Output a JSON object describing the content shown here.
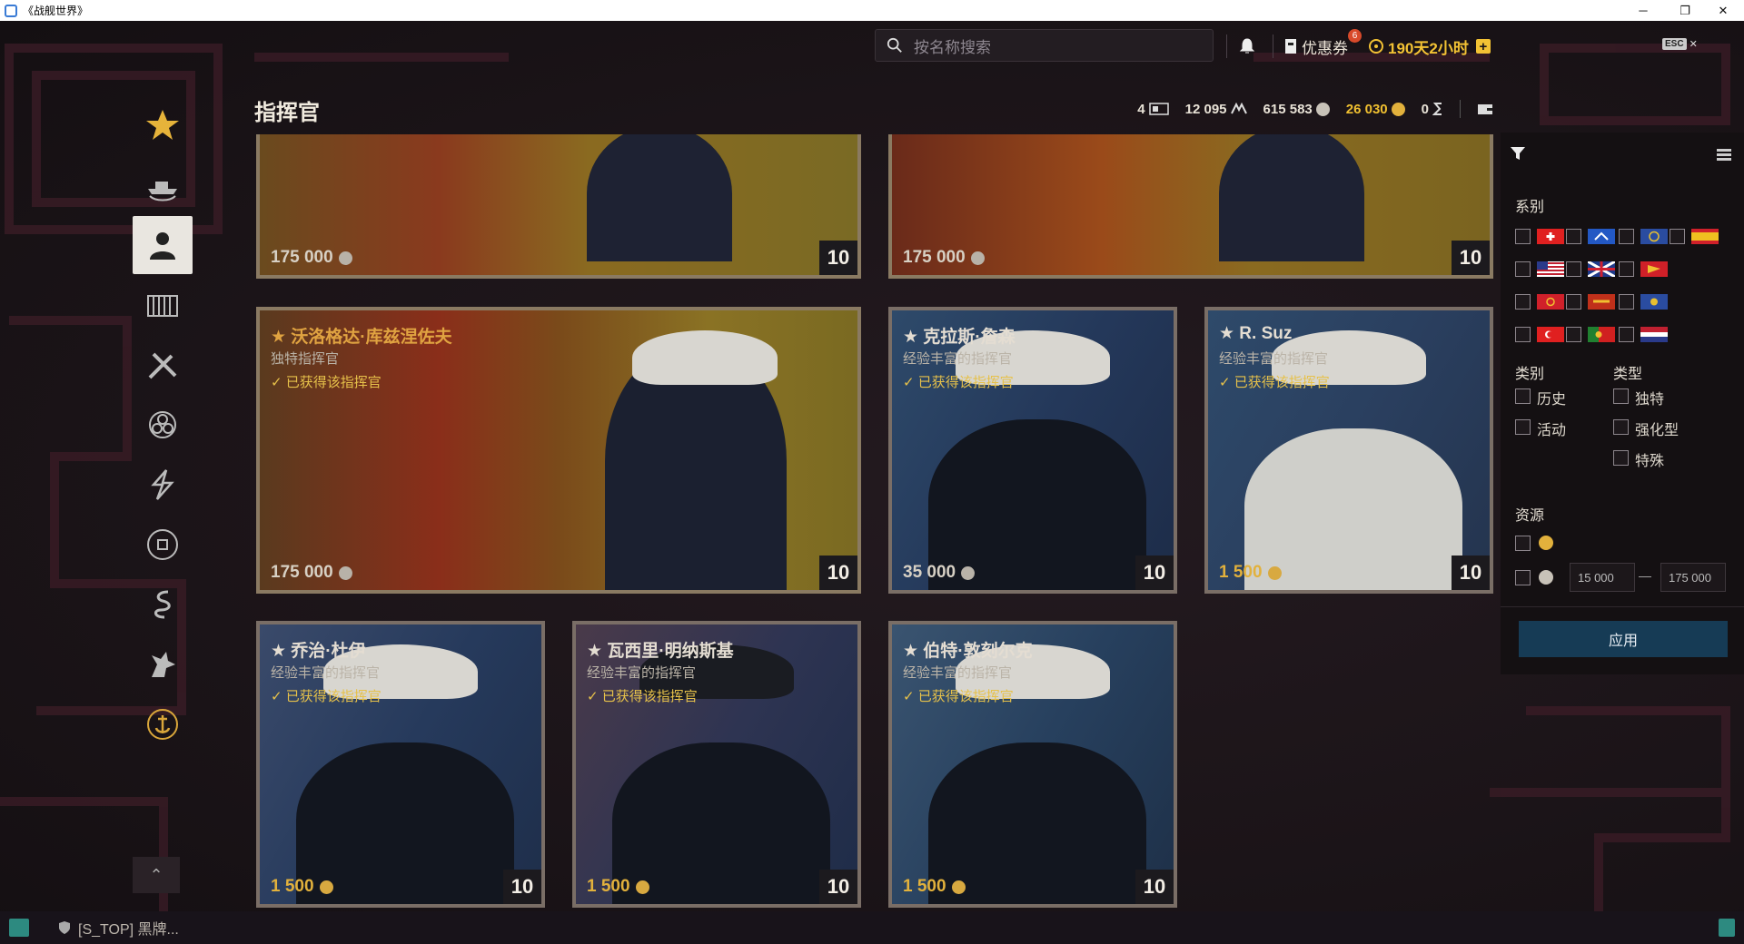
{
  "window": {
    "title": "《战舰世界》",
    "minimize": "─",
    "restore": "❐",
    "close": "✕"
  },
  "search": {
    "placeholder": "按名称搜索"
  },
  "topbar": {
    "coupon_label": "优惠券",
    "coupon_badge": "6",
    "premium_label": "190天2小时",
    "premium_add": "+",
    "esc_key": "ESC",
    "esc_close": "✕"
  },
  "page_title": "指挥官",
  "currencies": [
    {
      "icon": "slots-icon",
      "value": "4"
    },
    {
      "icon": "elite-xp-icon",
      "value": "12 095"
    },
    {
      "icon": "silver-credits-icon",
      "value": "615 583"
    },
    {
      "icon": "doubloons-icon",
      "value": "26 030"
    },
    {
      "icon": "steel-icon",
      "value": "0"
    }
  ],
  "nav": {
    "items": [
      {
        "icon": "star-icon"
      },
      {
        "icon": "ship-emblem-icon"
      },
      {
        "icon": "commander-icon"
      },
      {
        "icon": "port-buildings-icon"
      },
      {
        "icon": "crossed-tools-icon"
      },
      {
        "icon": "flag-roundel-icon"
      },
      {
        "icon": "lightning-icon"
      },
      {
        "icon": "coin-seal-icon"
      },
      {
        "icon": "dragon-icon"
      },
      {
        "icon": "griffin-icon"
      },
      {
        "icon": "anchor-wreath-icon"
      }
    ],
    "scroll_up": "⌃"
  },
  "cards_top": [
    {
      "price": "175 000",
      "level": "10"
    },
    {
      "price": "175 000",
      "level": "10"
    }
  ],
  "cards": [
    {
      "title": "★ 沃洛格达·库兹涅佐夫",
      "subtitle": "独特指挥官",
      "owned": "✓ 已获得该指挥官",
      "price": "175 000",
      "level": "10",
      "currency": "silver"
    },
    {
      "title": "★ 克拉斯·詹森",
      "subtitle": "经验丰富的指挥官",
      "owned": "✓ 已获得该指挥官",
      "price": "35 000",
      "level": "10",
      "currency": "silver"
    },
    {
      "title": "★ R. Suz",
      "subtitle": "经验丰富的指挥官",
      "owned": "✓ 已获得该指挥官",
      "price": "1 500",
      "level": "10",
      "currency": "gold"
    },
    {
      "title": "★ 乔治·杜伊",
      "subtitle": "经验丰富的指挥官",
      "owned": "✓ 已获得该指挥官",
      "price": "1 500",
      "level": "10",
      "currency": "gold"
    },
    {
      "title": "★ 瓦西里·明纳斯基",
      "subtitle": "经验丰富的指挥官",
      "owned": "✓ 已获得该指挥官",
      "price": "1 500",
      "level": "10",
      "currency": "gold"
    },
    {
      "title": "★ 伯特·敦刻尔克",
      "subtitle": "经验丰富的指挥官",
      "owned": "✓ 已获得该指挥官",
      "price": "1 500",
      "level": "10",
      "currency": "gold"
    }
  ],
  "filter": {
    "nation_label": "系别",
    "category_label": "类别",
    "type_label": "类型",
    "category_options": [
      "历史",
      "活动"
    ],
    "type_options": [
      "独特",
      "强化型",
      "特殊"
    ],
    "resource_label": "资源",
    "range_min": "15 000",
    "range_dash": "—",
    "range_max": "175 000",
    "apply_label": "应用"
  },
  "chat": {
    "text": "[S_TOP]  黑牌..."
  }
}
